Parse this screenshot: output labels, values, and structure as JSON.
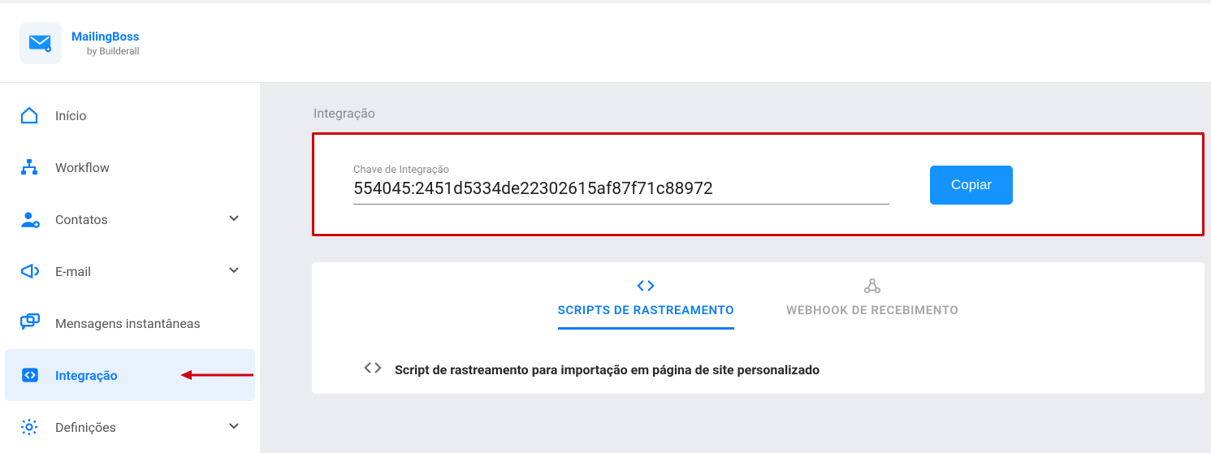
{
  "header": {
    "product": "MailingBoss",
    "by": "by ",
    "brand": "Builderall"
  },
  "sidebar": {
    "items": [
      {
        "label": "Início",
        "expandable": false
      },
      {
        "label": "Workflow",
        "expandable": false
      },
      {
        "label": "Contatos",
        "expandable": true
      },
      {
        "label": "E-mail",
        "expandable": true
      },
      {
        "label": "Mensagens instantâneas",
        "expandable": false
      },
      {
        "label": "Integração",
        "expandable": false
      },
      {
        "label": "Definições",
        "expandable": true
      }
    ]
  },
  "main": {
    "section_title": "Integração",
    "key_label": "Chave de Integração",
    "key_value": "554045:2451d5334de22302615af87f71c88972",
    "copy_label": "Copiar",
    "tabs": {
      "tracking": "SCRIPTS DE RASTREAMENTO",
      "webhook": "WEBHOOK DE RECEBIMENTO"
    },
    "accordion": {
      "title": "Script de rastreamento para importação em página de site personalizado"
    }
  }
}
